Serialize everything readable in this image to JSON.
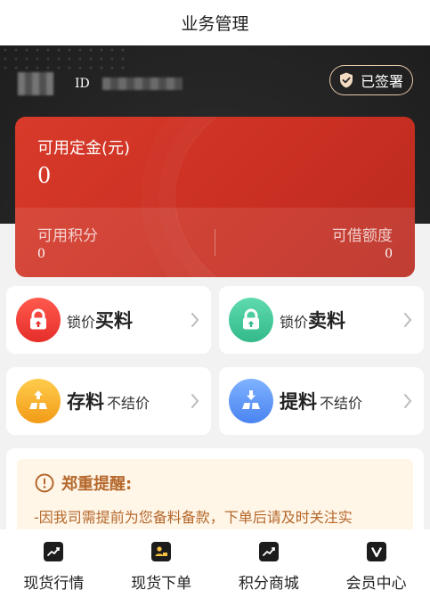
{
  "header": {
    "title": "业务管理"
  },
  "account": {
    "id_label": "ID",
    "signed_badge": "已签署"
  },
  "balance": {
    "title": "可用定金(元)",
    "value": "0",
    "points_label": "可用积分",
    "points_value": "0",
    "credit_label": "可借额度",
    "credit_value": "0"
  },
  "actions": [
    {
      "prefix": "锁价",
      "main": "买料",
      "suffix": "",
      "icon": "lock-icon",
      "color": "#e52d2a"
    },
    {
      "prefix": "锁价",
      "main": "卖料",
      "suffix": "",
      "icon": "lock-icon",
      "color": "#33b98a"
    },
    {
      "prefix": "",
      "main": "存料",
      "suffix": "不结价",
      "icon": "gold-bar-up-icon",
      "color": "#f29b16"
    },
    {
      "prefix": "",
      "main": "提料",
      "suffix": "不结价",
      "icon": "gold-bar-down-icon",
      "color": "#4a84f0"
    }
  ],
  "notice": {
    "title": "郑重提醒:",
    "text": "-因我司需提前为您备料备款，下单后请及时关注实"
  },
  "bottom_nav": [
    {
      "label": "现货行情",
      "icon": "chart-icon"
    },
    {
      "label": "现货下单",
      "icon": "order-icon"
    },
    {
      "label": "积分商城",
      "icon": "chart-icon"
    },
    {
      "label": "会员中心",
      "icon": "member-icon"
    }
  ],
  "colors": {
    "accent_red": "#c92f22",
    "notice_text": "#b5682c",
    "badge_border": "#e7c9a9"
  }
}
